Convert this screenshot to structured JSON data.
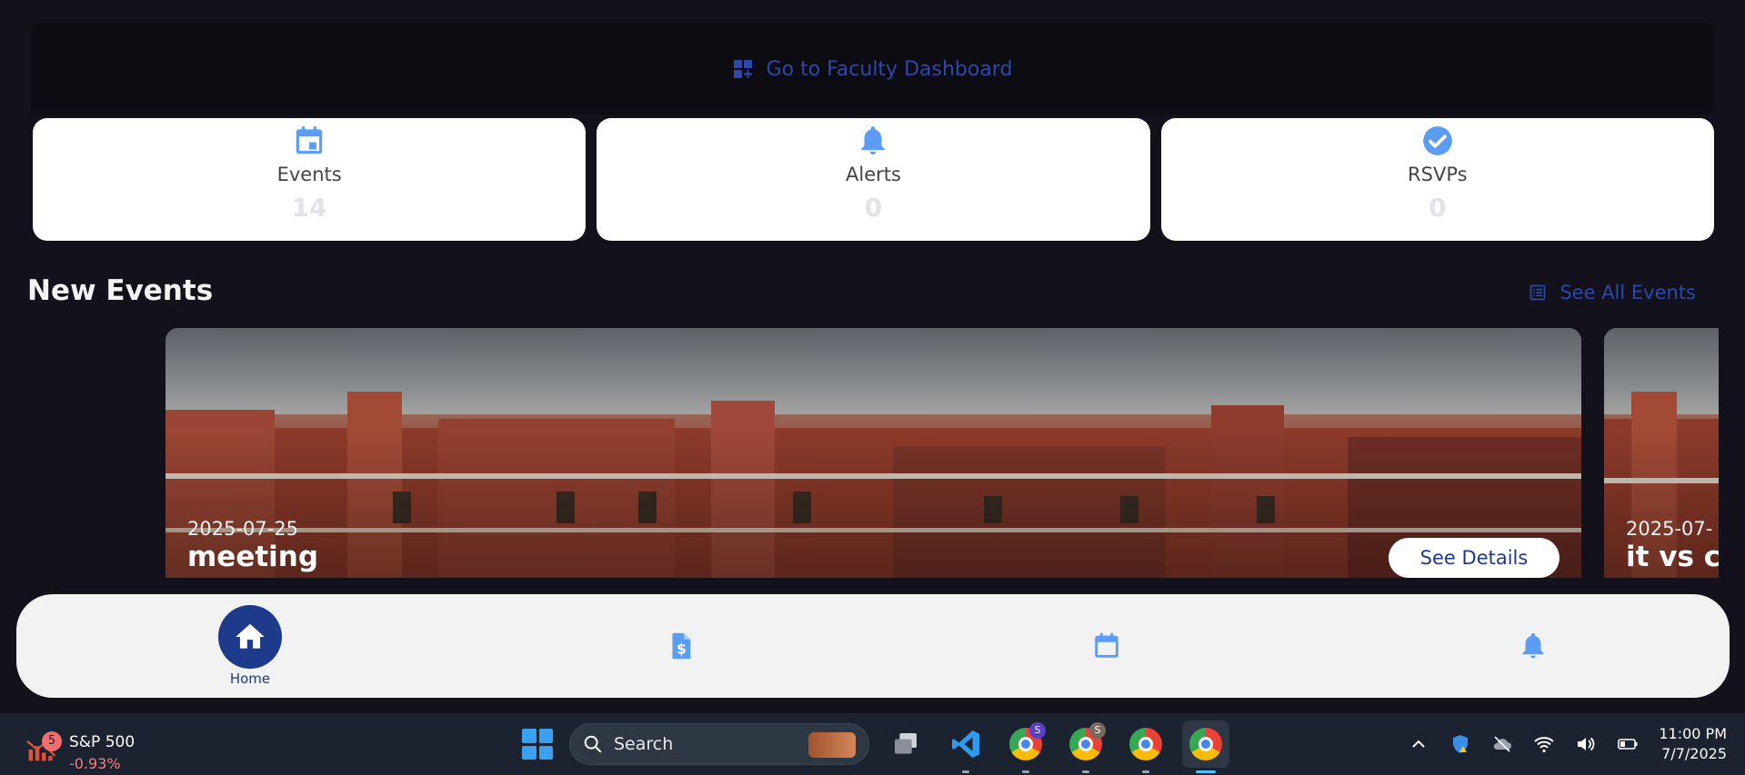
{
  "faculty_link": {
    "label": "Go to Faculty Dashboard",
    "icon": "dashboard-add-icon"
  },
  "stats": [
    {
      "label": "Events",
      "value": "14",
      "icon": "calendar-icon"
    },
    {
      "label": "Alerts",
      "value": "0",
      "icon": "bell-icon"
    },
    {
      "label": "RSVPs",
      "value": "0",
      "icon": "check-circle-icon"
    }
  ],
  "new_events": {
    "title": "New Events",
    "see_all_label": "See All Events",
    "events": [
      {
        "date": "2025-07-25",
        "name": "meeting",
        "button_label": "See Details"
      },
      {
        "date": "2025-07-",
        "name": "it vs cs"
      }
    ]
  },
  "bottom_nav": {
    "items": [
      {
        "label": "Home",
        "icon": "home-icon",
        "active": true
      },
      {
        "label": "",
        "icon": "invoice-dollar-icon"
      },
      {
        "label": "",
        "icon": "calendar-icon"
      },
      {
        "label": "",
        "icon": "bell-icon"
      }
    ]
  },
  "taskbar": {
    "stock": {
      "name": "S&P 500",
      "change": "-0.93%",
      "badge": "5"
    },
    "search_placeholder": "Search",
    "app_badges": [
      "S",
      "S"
    ],
    "clock": {
      "time": "11:00 PM",
      "date": "7/7/2025"
    }
  },
  "colors": {
    "background": "#13121c",
    "accent_blue": "#1e3a8a",
    "icon_blue": "#5b9cf5",
    "link_blue": "#2c49a9"
  }
}
